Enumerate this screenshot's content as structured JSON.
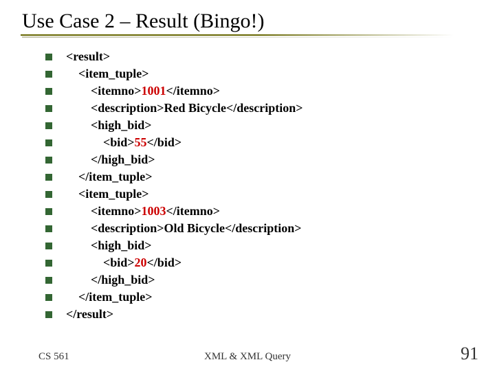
{
  "title": "Use Case 2 – Result (Bingo!)",
  "lines": [
    {
      "pre": "<result>",
      "num": "",
      "post": ""
    },
    {
      "pre": "    <item_tuple>",
      "num": "",
      "post": ""
    },
    {
      "pre": "        <itemno>",
      "num": "1001",
      "post": "</itemno>"
    },
    {
      "pre": "        <description>Red Bicycle</description>",
      "num": "",
      "post": ""
    },
    {
      "pre": "        <high_bid>",
      "num": "",
      "post": ""
    },
    {
      "pre": "            <bid>",
      "num": "55",
      "post": "</bid>"
    },
    {
      "pre": "        </high_bid>",
      "num": "",
      "post": ""
    },
    {
      "pre": "    </item_tuple>",
      "num": "",
      "post": ""
    },
    {
      "pre": "    <item_tuple>",
      "num": "",
      "post": ""
    },
    {
      "pre": "        <itemno>",
      "num": "1003",
      "post": "</itemno>"
    },
    {
      "pre": "        <description>Old Bicycle</description>",
      "num": "",
      "post": ""
    },
    {
      "pre": "        <high_bid>",
      "num": "",
      "post": ""
    },
    {
      "pre": "            <bid>",
      "num": "20",
      "post": "</bid>"
    },
    {
      "pre": "        </high_bid>",
      "num": "",
      "post": ""
    },
    {
      "pre": "    </item_tuple>",
      "num": "",
      "post": ""
    },
    {
      "pre": "</result>",
      "num": "",
      "post": ""
    }
  ],
  "footer": {
    "left": "CS 561",
    "center": "XML & XML Query",
    "right": "91"
  }
}
